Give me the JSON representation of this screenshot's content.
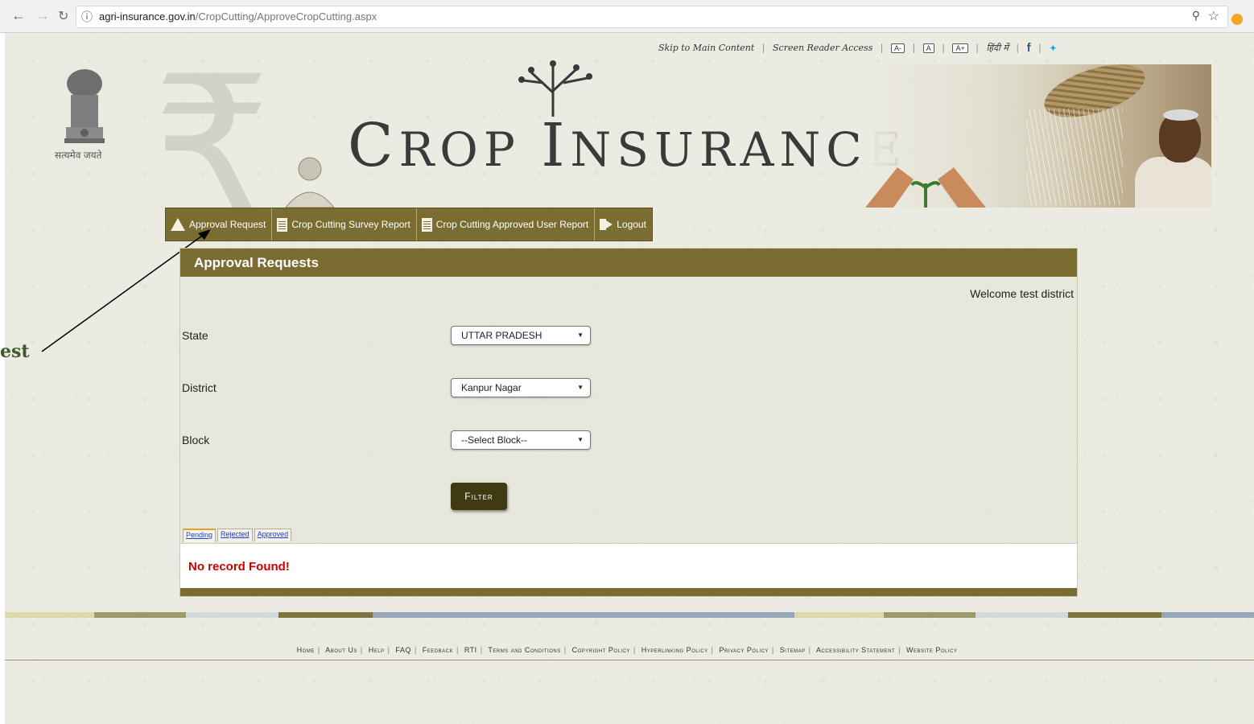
{
  "browser": {
    "url_host": "agri-insurance.gov.in",
    "url_path": "/CropCutting/ApproveCropCutting.aspx"
  },
  "utility": {
    "skip": "Skip to Main Content",
    "screen_reader": "Screen Reader Access",
    "font_small": "A-",
    "font_normal": "A",
    "font_large": "A+",
    "hindi": "हिंदी में",
    "facebook": "f"
  },
  "header": {
    "emblem_text": "सत्यमेव जयते",
    "title_first_initial": "C",
    "title_first_rest": "ROP",
    "title_second_initial": "I",
    "title_second_rest": "NSURANCE",
    "rupee_symbol": "₹"
  },
  "menu": {
    "items": [
      {
        "label": "Approval Request",
        "icon": "approval-icon"
      },
      {
        "label": "Crop Cutting Survey Report",
        "icon": "document-icon"
      },
      {
        "label": "Crop Cutting Approved User Report",
        "icon": "document-icon"
      },
      {
        "label": "Logout",
        "icon": "logout-icon"
      }
    ]
  },
  "annotation": {
    "label": "est"
  },
  "panel": {
    "title": "Approval Requests",
    "welcome": "Welcome test district",
    "state_label": "State",
    "state_value": "UTTAR PRADESH",
    "district_label": "District",
    "district_value": "Kanpur Nagar",
    "block_label": "Block",
    "block_value": "--Select Block--",
    "filter_label": "Filter",
    "tabs": [
      "Pending",
      "Rejected",
      "Approved"
    ],
    "result_message": "No record Found!"
  },
  "colors": {
    "brand": "#7b6d32",
    "button": "#3f3a12",
    "error": "#cc0000"
  },
  "footer": {
    "links": [
      "Home",
      "About Us",
      "Help",
      "FAQ",
      "Feedback",
      "RTI",
      "Terms and Conditions",
      "Copyright Policy",
      "Hyperlinking Policy",
      "Privacy Policy",
      "Sitemap",
      "Accessibility Statement",
      "Website Policy"
    ]
  }
}
